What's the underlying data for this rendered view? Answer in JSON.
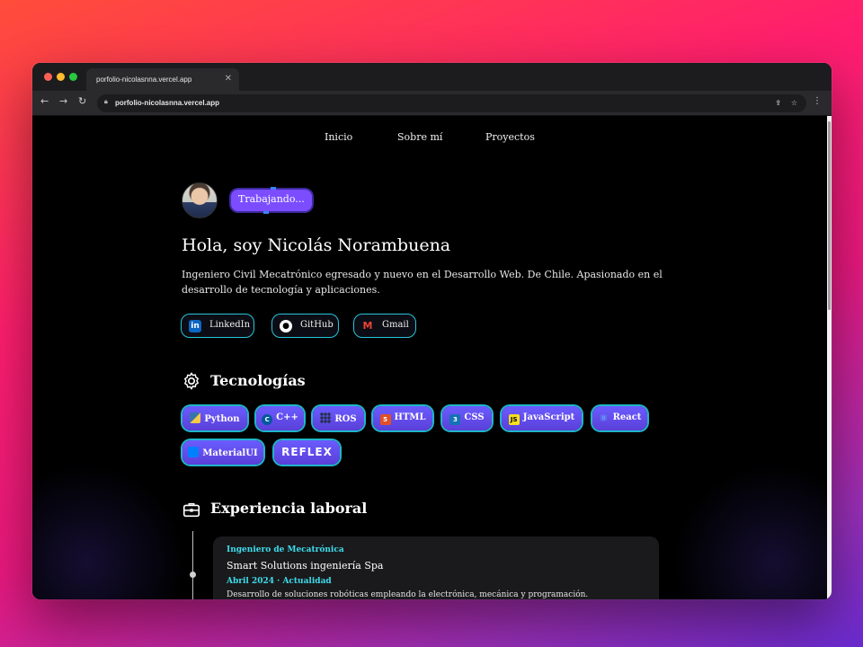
{
  "browser": {
    "tab_title": "porfolio-nicolasnna.vercel.app",
    "url": "porfolio-nicolasnna.vercel.app"
  },
  "nav": {
    "items": [
      "Inicio",
      "Sobre mí",
      "Proyectos"
    ]
  },
  "hero": {
    "status": "Trabajando...",
    "title": "Hola, soy Nicolás Norambuena",
    "description": "Ingeniero Civil Mecatrónico egresado y nuevo en el Desarrollo Web. De Chile. Apasionado en el desarrollo de tecnología y aplicaciones."
  },
  "social": [
    {
      "label": "LinkedIn",
      "icon": "linkedin-icon"
    },
    {
      "label": "GitHub",
      "icon": "github-icon"
    },
    {
      "label": "Gmail",
      "icon": "gmail-icon"
    }
  ],
  "technologies": {
    "title": "Tecnologías",
    "items": [
      {
        "label": "Python",
        "icon": "python-icon",
        "color": "#f7c948"
      },
      {
        "label": "C++",
        "icon": "cpp-icon",
        "color": "#00599c"
      },
      {
        "label": "ROS",
        "icon": "ros-icon",
        "color": "#22314e"
      },
      {
        "label": "HTML",
        "icon": "html5-icon",
        "color": "#e34f26"
      },
      {
        "label": "CSS",
        "icon": "css3-icon",
        "color": "#1572b6"
      },
      {
        "label": "JavaScript",
        "icon": "javascript-icon",
        "color": "#f7df1e"
      },
      {
        "label": "React",
        "icon": "react-icon",
        "color": "#61dafb"
      },
      {
        "label": "MaterialUI",
        "icon": "materialui-icon",
        "color": "#007fff"
      },
      {
        "label": "REFLEX",
        "icon": "reflex-logo",
        "color": "#ffffff"
      }
    ]
  },
  "experience": {
    "title": "Experiencia laboral",
    "items": [
      {
        "role": "Ingeniero de Mecatrónica",
        "company": "Smart Solutions ingeniería Spa",
        "date": "Abril 2024 · Actualidad",
        "description": "Desarrollo de soluciones robóticas empleando la electrónica, mecánica y programación."
      }
    ]
  }
}
